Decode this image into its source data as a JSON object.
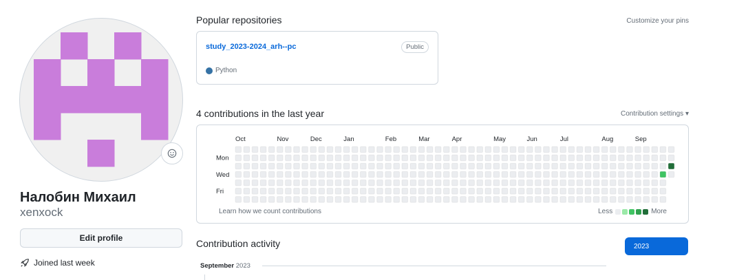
{
  "profile": {
    "fullname": "Налобин Михаил",
    "login": "xenxock",
    "edit_label": "Edit profile",
    "joined": "Joined last week",
    "avatar_color": "#c97ddb"
  },
  "pinned": {
    "title": "Popular repositories",
    "customize_label": "Customize your pins",
    "repos": [
      {
        "name": "study_2023-2024_arh--pc",
        "visibility": "Public",
        "language": "Python",
        "language_color": "#3572A5"
      }
    ]
  },
  "contributions": {
    "title": "4 contributions in the last year",
    "settings_label": "Contribution settings",
    "months": [
      "Oct",
      "Nov",
      "Dec",
      "Jan",
      "Feb",
      "Mar",
      "Apr",
      "May",
      "Jun",
      "Jul",
      "Aug",
      "Sep"
    ],
    "days": [
      "Mon",
      "Wed",
      "Fri"
    ],
    "learn_label": "Learn how we count contributions",
    "legend_less": "Less",
    "legend_more": "More",
    "level_colors": [
      "#ebedf0",
      "#9be9a8",
      "#40c463",
      "#30a14e",
      "#216e39"
    ],
    "active_cells": [
      {
        "week": 52,
        "day": 2,
        "level": 4
      },
      {
        "week": 51,
        "day": 3,
        "level": 2
      }
    ]
  },
  "activity": {
    "title": "Contribution activity",
    "year_button": "2023",
    "month": "September",
    "year": "2023"
  }
}
